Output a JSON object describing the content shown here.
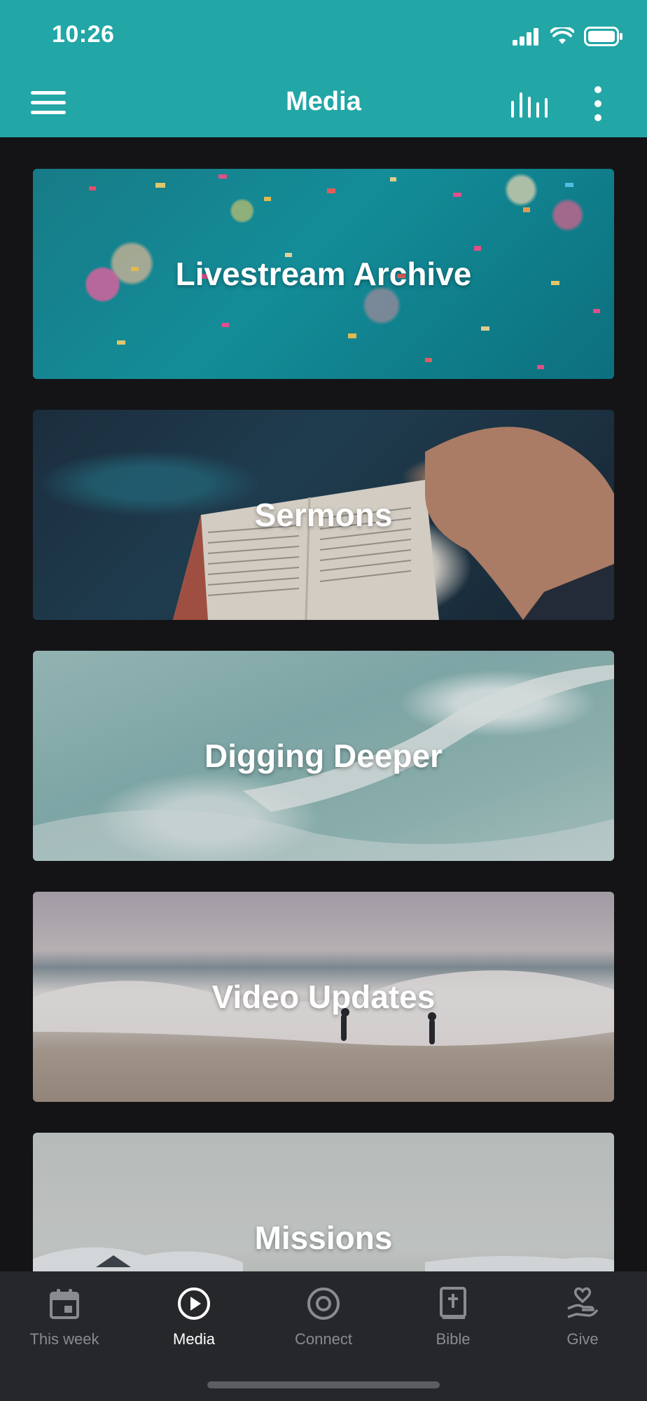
{
  "status_bar": {
    "time": "10:26"
  },
  "header": {
    "title": "Media"
  },
  "cards": [
    {
      "label": "Livestream Archive"
    },
    {
      "label": "Sermons"
    },
    {
      "label": "Digging Deeper"
    },
    {
      "label": "Video Updates"
    },
    {
      "label": "Missions"
    }
  ],
  "tabs": [
    {
      "label": "This week",
      "icon": "calendar-icon",
      "active": false
    },
    {
      "label": "Media",
      "icon": "play-circle-icon",
      "active": true
    },
    {
      "label": "Connect",
      "icon": "target-icon",
      "active": false
    },
    {
      "label": "Bible",
      "icon": "bible-icon",
      "active": false
    },
    {
      "label": "Give",
      "icon": "give-hand-heart-icon",
      "active": false
    }
  ],
  "colors": {
    "header": "#22a6a6",
    "background": "#141416",
    "tabbar": "#26272a"
  }
}
